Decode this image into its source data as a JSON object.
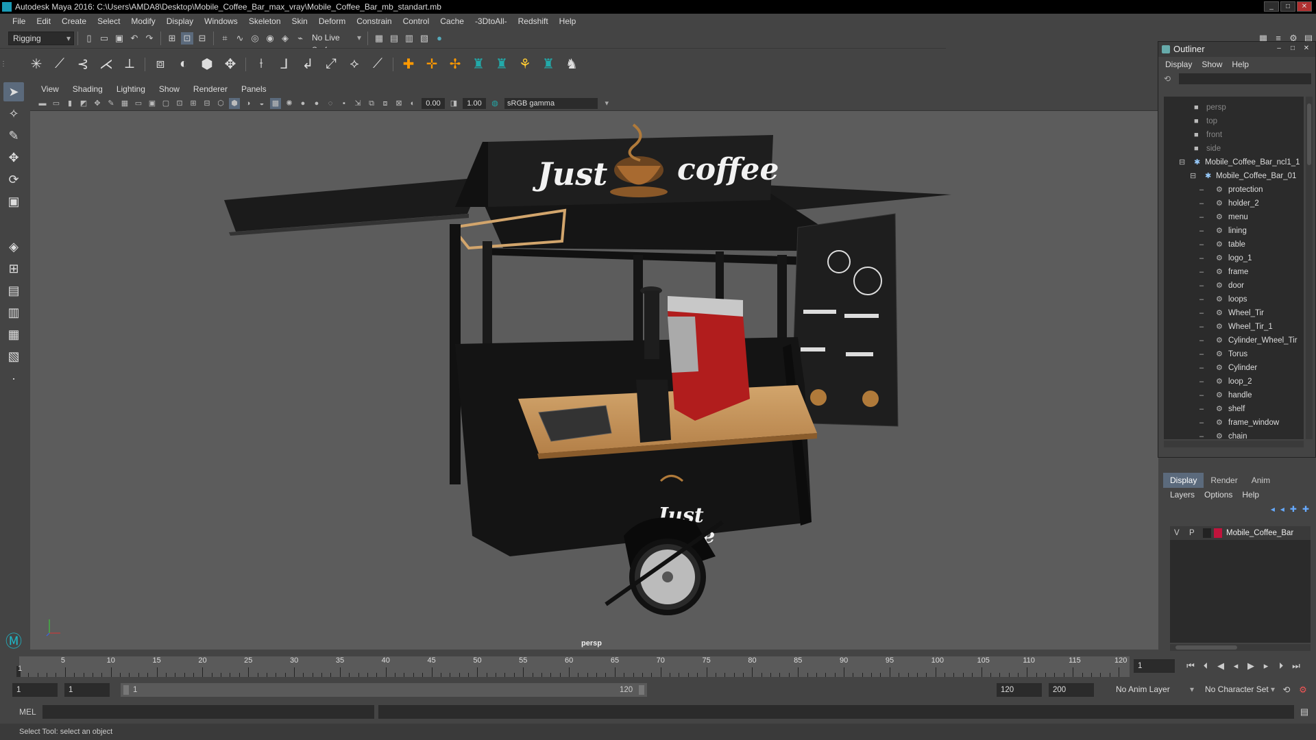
{
  "window": {
    "title": "Autodesk Maya 2016: C:\\Users\\AMDA8\\Desktop\\Mobile_Coffee_Bar_max_vray\\Mobile_Coffee_Bar_mb_standart.mb"
  },
  "menubar": [
    "File",
    "Edit",
    "Create",
    "Select",
    "Modify",
    "Display",
    "Windows",
    "Skeleton",
    "Skin",
    "Deform",
    "Constrain",
    "Control",
    "Cache",
    "-3DtoAll-",
    "Redshift",
    "Help"
  ],
  "statusline": {
    "menu_set": "Rigging",
    "live_surface": "No Live Surface"
  },
  "viewport": {
    "menu": [
      "View",
      "Shading",
      "Lighting",
      "Show",
      "Renderer",
      "Panels"
    ],
    "exposure": "0.00",
    "gamma_value": "1.00",
    "color_space": "sRGB gamma",
    "camera_label": "persp",
    "scene": {
      "sign_left": "Just",
      "sign_right": "coffee",
      "cart_line1": "Just",
      "cart_line2": "coffee"
    }
  },
  "outliner": {
    "title": "Outliner",
    "menu": [
      "Display",
      "Show",
      "Help"
    ],
    "cameras": [
      "persp",
      "top",
      "front",
      "side"
    ],
    "groups": [
      "Mobile_Coffee_Bar_ncl1_1",
      "Mobile_Coffee_Bar_01"
    ],
    "items": [
      "protection",
      "holder_2",
      "menu",
      "lining",
      "table",
      "logo_1",
      "frame",
      "door",
      "loops",
      "Wheel_Tir",
      "Wheel_Tir_1",
      "Cylinder_Wheel_Tir",
      "Torus",
      "Cylinder",
      "loop_2",
      "handle",
      "shelf",
      "frame_window",
      "chain"
    ]
  },
  "layers": {
    "tabs": [
      "Display",
      "Render",
      "Anim"
    ],
    "active_tab": "Display",
    "menu": [
      "Layers",
      "Options",
      "Help"
    ],
    "row": {
      "v": "V",
      "p": "P",
      "name": "Mobile_Coffee_Bar",
      "color": "#c0143c"
    }
  },
  "timeline": {
    "ticks": [
      "5",
      "10",
      "15",
      "20",
      "25",
      "30",
      "35",
      "40",
      "45",
      "50",
      "55",
      "60",
      "65",
      "70",
      "75",
      "80",
      "85",
      "90",
      "95",
      "100",
      "105",
      "110",
      "115",
      "120"
    ],
    "current_frame": "1",
    "start_marker": "1"
  },
  "range": {
    "start": "1",
    "inner_start": "1",
    "slider_start": "1",
    "slider_end": "120",
    "anim_end": "120",
    "max_end": "200",
    "anim_layer": "No Anim Layer",
    "char_set": "No Character Set"
  },
  "cmdline": {
    "mode": "MEL"
  },
  "helpline": {
    "text": "Select Tool: select an object"
  }
}
